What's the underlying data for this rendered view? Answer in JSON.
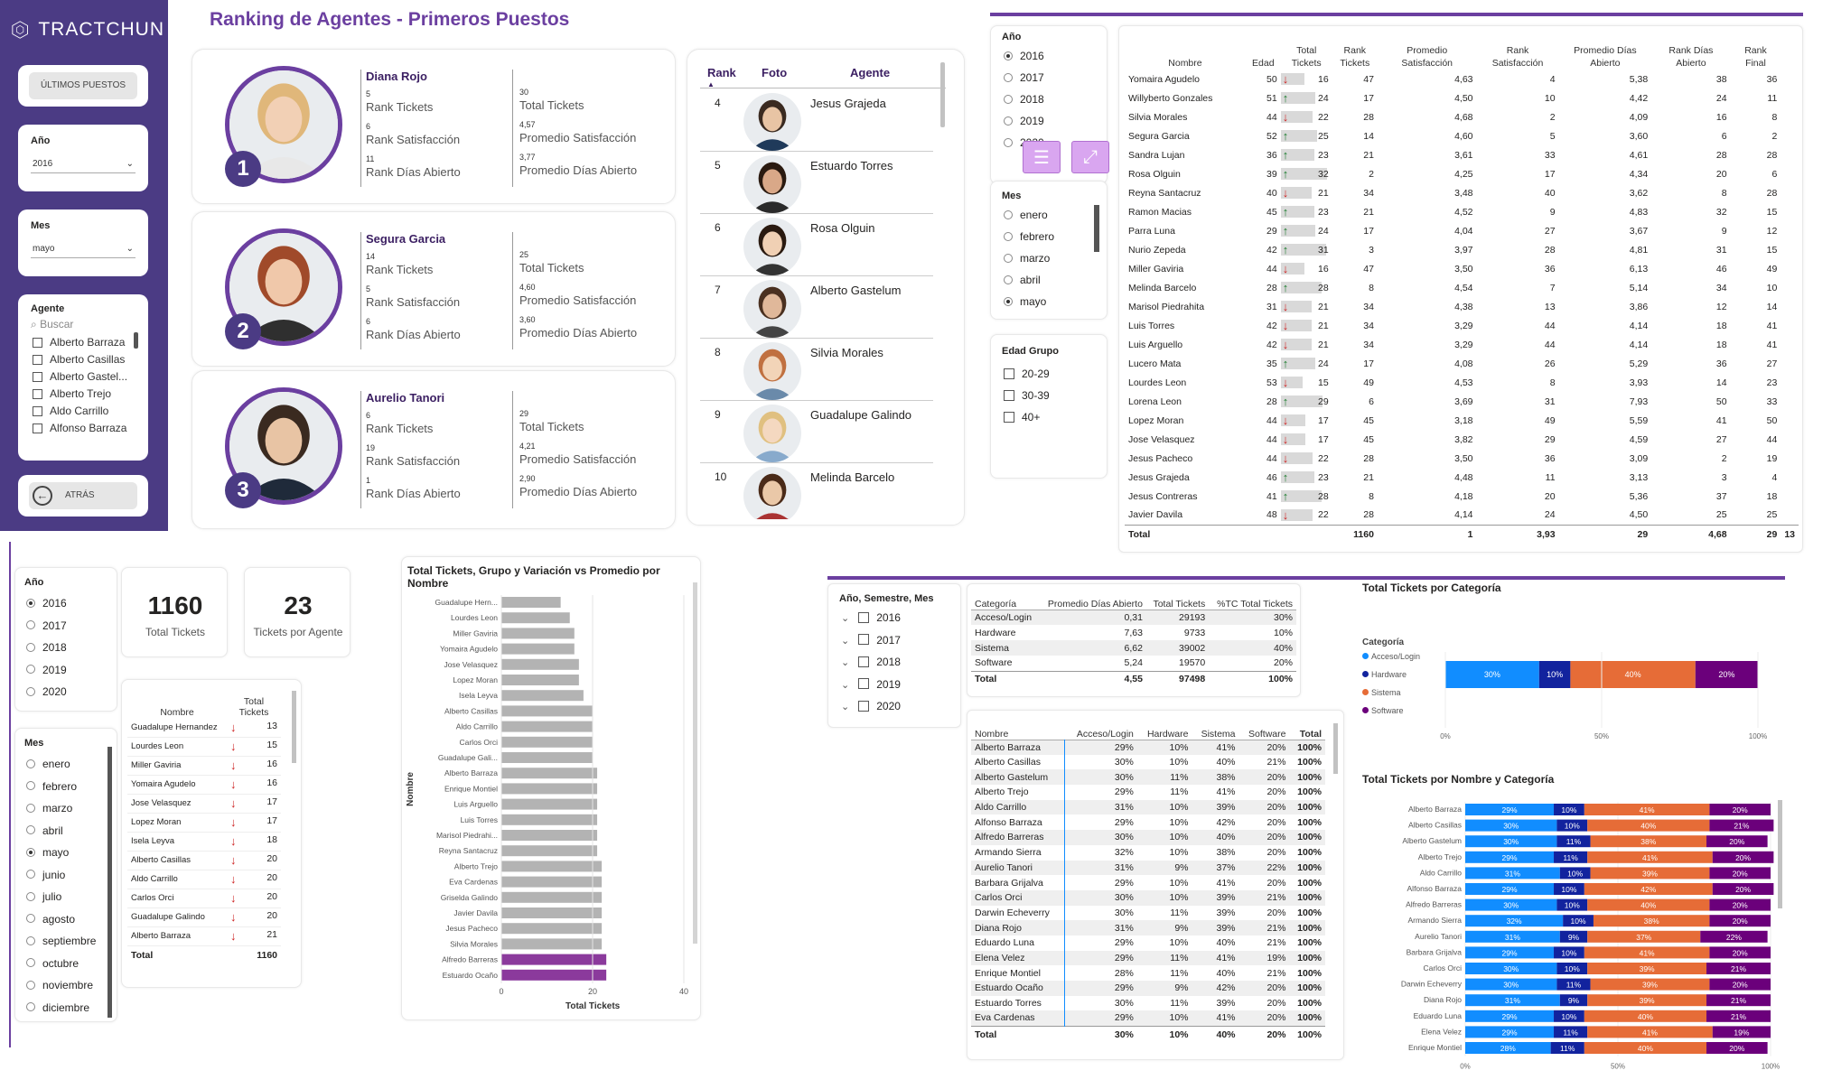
{
  "brand": "TRACTCHUN",
  "sidebar": {
    "ultimos_label": "ÚLTIMOS PUESTOS",
    "year_label": "Año",
    "year_value": "2016",
    "month_label": "Mes",
    "month_value": "mayo",
    "agent_label": "Agente",
    "agent_search_placeholder": "Buscar",
    "agents": [
      "Alberto Barraza",
      "Alberto Casillas",
      "Alberto Gastel...",
      "Alberto Trejo",
      "Aldo Carrillo",
      "Alfonso Barraza"
    ],
    "back_label": "ATRÁS"
  },
  "page_title": "Ranking de Agentes - Primeros Puestos",
  "top3": [
    {
      "rank": "1",
      "name": "Diana Rojo",
      "rank_tickets": "5",
      "rank_tickets_label": "Rank Tickets",
      "rank_sat": "6",
      "rank_sat_label": "Rank Satisfacción",
      "rank_dias": "11",
      "rank_dias_label": "Rank Días Abierto",
      "total_tickets": "30",
      "total_tickets_label": "Total Tickets",
      "prom_sat": "4,57",
      "prom_sat_label": "Promedio Satisfacción",
      "prom_dias": "3,77",
      "prom_dias_label": "Promedio Días Abierto"
    },
    {
      "rank": "2",
      "name": "Segura Garcia",
      "rank_tickets": "14",
      "rank_tickets_label": "Rank Tickets",
      "rank_sat": "5",
      "rank_sat_label": "Rank Satisfacción",
      "rank_dias": "6",
      "rank_dias_label": "Rank Días Abierto",
      "total_tickets": "25",
      "total_tickets_label": "Total Tickets",
      "prom_sat": "4,60",
      "prom_sat_label": "Promedio Satisfacción",
      "prom_dias": "3,60",
      "prom_dias_label": "Promedio Días Abierto"
    },
    {
      "rank": "3",
      "name": "Aurelio Tanori",
      "rank_tickets": "6",
      "rank_tickets_label": "Rank Tickets",
      "rank_sat": "19",
      "rank_sat_label": "Rank Satisfacción",
      "rank_dias": "1",
      "rank_dias_label": "Rank Días Abierto",
      "total_tickets": "29",
      "total_tickets_label": "Total Tickets",
      "prom_sat": "4,21",
      "prom_sat_label": "Promedio Satisfacción",
      "prom_dias": "2,90",
      "prom_dias_label": "Promedio Días Abierto"
    }
  ],
  "rank_list": {
    "headers": [
      "Rank",
      "Foto",
      "Agente"
    ],
    "rows": [
      [
        "4",
        "Jesus Grajeda"
      ],
      [
        "5",
        "Estuardo Torres"
      ],
      [
        "6",
        "Rosa Olguin"
      ],
      [
        "7",
        "Alberto Gastelum"
      ],
      [
        "8",
        "Silvia Morales"
      ],
      [
        "9",
        "Guadalupe Galindo"
      ],
      [
        "10",
        "Melinda Barcelo"
      ]
    ]
  },
  "filters_top": {
    "year_label": "Año",
    "years": [
      "2016",
      "2017",
      "2018",
      "2019",
      "2020"
    ],
    "year_selected": "2016",
    "month_label": "Mes",
    "months": [
      "enero",
      "febrero",
      "marzo",
      "abril",
      "mayo"
    ],
    "month_selected": "mayo",
    "age_label": "Edad Grupo",
    "ages": [
      "20-29",
      "30-39",
      "40+"
    ]
  },
  "big_table": {
    "headers": [
      "Nombre",
      "Edad",
      "Total Tickets",
      "Rank Tickets",
      "Promedio Satisfacción",
      "Rank Satisfacción",
      "Promedio Días Abierto",
      "Rank Días Abierto",
      "Rank Final"
    ],
    "rows": [
      [
        "Yomaira Agudelo",
        "50",
        "dn",
        "16",
        "47",
        "4,63",
        "4",
        "5,38",
        "38",
        "36"
      ],
      [
        "Willyberto Gonzales",
        "51",
        "up",
        "24",
        "17",
        "4,50",
        "10",
        "4,42",
        "24",
        "11"
      ],
      [
        "Silvia Morales",
        "44",
        "dn",
        "22",
        "28",
        "4,68",
        "2",
        "4,09",
        "16",
        "8"
      ],
      [
        "Segura Garcia",
        "52",
        "up",
        "25",
        "14",
        "4,60",
        "5",
        "3,60",
        "6",
        "2"
      ],
      [
        "Sandra Lujan",
        "36",
        "up",
        "23",
        "21",
        "3,61",
        "33",
        "4,61",
        "28",
        "28"
      ],
      [
        "Rosa Olguin",
        "39",
        "up",
        "32",
        "2",
        "4,25",
        "17",
        "4,34",
        "20",
        "6"
      ],
      [
        "Reyna Santacruz",
        "40",
        "dn",
        "21",
        "34",
        "3,48",
        "40",
        "3,62",
        "8",
        "28"
      ],
      [
        "Ramon Macias",
        "45",
        "up",
        "23",
        "21",
        "4,52",
        "9",
        "4,83",
        "32",
        "15"
      ],
      [
        "Parra Luna",
        "29",
        "up",
        "24",
        "17",
        "4,04",
        "27",
        "3,67",
        "9",
        "12"
      ],
      [
        "Nurio Zepeda",
        "42",
        "up",
        "31",
        "3",
        "3,97",
        "28",
        "4,81",
        "31",
        "15"
      ],
      [
        "Miller Gaviria",
        "44",
        "dn",
        "16",
        "47",
        "3,50",
        "36",
        "6,13",
        "46",
        "49"
      ],
      [
        "Melinda Barcelo",
        "28",
        "up",
        "28",
        "8",
        "4,54",
        "7",
        "5,14",
        "34",
        "10"
      ],
      [
        "Marisol Piedrahita",
        "31",
        "dn",
        "21",
        "34",
        "4,38",
        "13",
        "3,86",
        "12",
        "14"
      ],
      [
        "Luis Torres",
        "42",
        "dn",
        "21",
        "34",
        "3,29",
        "44",
        "4,14",
        "18",
        "41"
      ],
      [
        "Luis Arguello",
        "42",
        "dn",
        "21",
        "34",
        "3,29",
        "44",
        "4,14",
        "18",
        "41"
      ],
      [
        "Lucero Mata",
        "35",
        "up",
        "24",
        "17",
        "4,08",
        "26",
        "5,29",
        "36",
        "27"
      ],
      [
        "Lourdes Leon",
        "53",
        "dn",
        "15",
        "49",
        "4,53",
        "8",
        "3,93",
        "14",
        "23"
      ],
      [
        "Lorena Leon",
        "28",
        "up",
        "29",
        "6",
        "3,69",
        "31",
        "7,93",
        "50",
        "33"
      ],
      [
        "Lopez Moran",
        "44",
        "dn",
        "17",
        "45",
        "3,18",
        "49",
        "5,59",
        "41",
        "50"
      ],
      [
        "Jose Velasquez",
        "44",
        "dn",
        "17",
        "45",
        "3,82",
        "29",
        "4,59",
        "27",
        "44"
      ],
      [
        "Jesus Pacheco",
        "44",
        "dn",
        "22",
        "28",
        "3,50",
        "36",
        "3,09",
        "2",
        "19"
      ],
      [
        "Jesus Grajeda",
        "46",
        "up",
        "23",
        "21",
        "4,48",
        "11",
        "3,13",
        "3",
        "4"
      ],
      [
        "Jesus Contreras",
        "41",
        "up",
        "28",
        "8",
        "4,18",
        "20",
        "5,36",
        "37",
        "18"
      ],
      [
        "Javier Davila",
        "48",
        "dn",
        "22",
        "28",
        "4,14",
        "24",
        "4,50",
        "25",
        "25"
      ]
    ],
    "total": [
      "Total",
      "",
      "",
      "1160",
      "1",
      "3,93",
      "29",
      "4,68",
      "29",
      "13"
    ]
  },
  "bl": {
    "year_label": "Año",
    "years": [
      "2016",
      "2017",
      "2018",
      "2019",
      "2020"
    ],
    "year_selected": "2016",
    "month_label": "Mes",
    "months": [
      "enero",
      "febrero",
      "marzo",
      "abril",
      "mayo",
      "junio",
      "julio",
      "agosto",
      "septiembre",
      "octubre",
      "noviembre",
      "diciembre"
    ],
    "month_selected": "mayo",
    "kpi1_value": "1160",
    "kpi1_label": "Total Tickets",
    "kpi2_value": "23",
    "kpi2_label": "Tickets por Agente",
    "small_table": {
      "headers": [
        "Nombre",
        "Total Tickets"
      ],
      "rows": [
        [
          "Guadalupe Hernandez",
          "13"
        ],
        [
          "Lourdes Leon",
          "15"
        ],
        [
          "Miller Gaviria",
          "16"
        ],
        [
          "Yomaira Agudelo",
          "16"
        ],
        [
          "Jose Velasquez",
          "17"
        ],
        [
          "Lopez Moran",
          "17"
        ],
        [
          "Isela Leyva",
          "18"
        ],
        [
          "Alberto Casillas",
          "20"
        ],
        [
          "Aldo Carrillo",
          "20"
        ],
        [
          "Carlos Orci",
          "20"
        ],
        [
          "Guadalupe Galindo",
          "20"
        ],
        [
          "Alberto Barraza",
          "21"
        ]
      ],
      "total": [
        "Total",
        "1160"
      ]
    }
  },
  "bar_chart": {
    "title": "Total Tickets, Grupo y Variación vs Promedio por Nombre"
  },
  "chart_data": [
    {
      "type": "bar",
      "orientation": "horizontal",
      "title": "Total Tickets, Grupo y Variación vs Promedio por Nombre",
      "xlabel": "Total Tickets",
      "ylabel": "Nombre",
      "xlim": [
        0,
        40
      ],
      "xticks": [
        "0",
        "20",
        "40"
      ],
      "categories": [
        "Guadalupe Hern...",
        "Lourdes Leon",
        "Miller Gaviria",
        "Yomaira Agudelo",
        "Jose Velasquez",
        "Lopez Moran",
        "Isela Leyva",
        "Alberto Casillas",
        "Aldo Carrillo",
        "Carlos Orci",
        "Guadalupe Gali...",
        "Alberto Barraza",
        "Enrique Montiel",
        "Luis Arguello",
        "Luis Torres",
        "Marisol Piedrahi...",
        "Reyna Santacruz",
        "Alberto Trejo",
        "Eva Cardenas",
        "Griselda Galindo",
        "Javier Davila",
        "Jesus Pacheco",
        "Silvia Morales",
        "Alfredo Barreras",
        "Estuardo Ocaño"
      ],
      "values": [
        13,
        15,
        16,
        16,
        17,
        17,
        18,
        20,
        20,
        20,
        20,
        21,
        21,
        21,
        21,
        21,
        21,
        22,
        22,
        22,
        22,
        22,
        22,
        23,
        23
      ],
      "highlight": [
        "Alfredo Barreras",
        "Estuardo Ocaño"
      ],
      "bar_color": "#b3b3b3",
      "highlight_color": "#8b3a9c"
    },
    {
      "type": "bar",
      "orientation": "horizontal",
      "stacked_percent": true,
      "title": "Total Tickets por Categoría",
      "legend_title": "Categoría",
      "legend_position": "left",
      "series": [
        {
          "name": "Acceso/Login",
          "values": [
            30
          ]
        },
        {
          "name": "Hardware",
          "values": [
            10
          ]
        },
        {
          "name": "Sistema",
          "values": [
            40
          ]
        },
        {
          "name": "Software",
          "values": [
            20
          ]
        }
      ],
      "xticks": [
        "0%",
        "50%",
        "100%"
      ]
    },
    {
      "type": "bar",
      "orientation": "horizontal",
      "stacked_percent": true,
      "title": "Total Tickets por Nombre y Categoría",
      "xticks": [
        "0%",
        "50%",
        "100%"
      ],
      "categories": [
        "Alberto Barraza",
        "Alberto Casillas",
        "Alberto Gastelum",
        "Alberto Trejo",
        "Aldo Carrillo",
        "Alfonso Barraza",
        "Alfredo Barreras",
        "Armando Sierra",
        "Aurelio Tanori",
        "Barbara Grijalva",
        "Carlos Orci",
        "Darwin Echeverry",
        "Diana Rojo",
        "Eduardo Luna",
        "Elena Velez",
        "Enrique Montiel"
      ],
      "series": [
        {
          "name": "Acceso/Login",
          "values": [
            29,
            30,
            30,
            29,
            31,
            29,
            30,
            32,
            31,
            29,
            30,
            30,
            31,
            29,
            29,
            28
          ]
        },
        {
          "name": "Hardware",
          "values": [
            10,
            10,
            11,
            11,
            10,
            10,
            10,
            10,
            9,
            10,
            10,
            11,
            9,
            10,
            11,
            11
          ]
        },
        {
          "name": "Sistema",
          "values": [
            41,
            40,
            38,
            41,
            39,
            42,
            40,
            38,
            37,
            41,
            39,
            39,
            39,
            40,
            41,
            40
          ]
        },
        {
          "name": "Software",
          "values": [
            20,
            21,
            20,
            20,
            20,
            20,
            20,
            20,
            22,
            20,
            21,
            20,
            21,
            21,
            19,
            20
          ]
        }
      ]
    }
  ],
  "colors": {
    "acceso": "#118dff",
    "hardware": "#12239e",
    "sistema": "#e66c37",
    "software": "#6b007b",
    "purple": "#6b3fa0"
  },
  "br_filters": {
    "title": "Año, Semestre, Mes",
    "years": [
      "2016",
      "2017",
      "2018",
      "2019",
      "2020"
    ]
  },
  "cat_table": {
    "headers": [
      "Categoría",
      "Promedio Días Abierto",
      "Total Tickets",
      "%TC Total Tickets"
    ],
    "rows": [
      [
        "Acceso/Login",
        "0,31",
        "29193",
        "30%"
      ],
      [
        "Hardware",
        "7,63",
        "9733",
        "10%"
      ],
      [
        "Sistema",
        "6,62",
        "39002",
        "40%"
      ],
      [
        "Software",
        "5,24",
        "19570",
        "20%"
      ]
    ],
    "total": [
      "Total",
      "4,55",
      "97498",
      "100%"
    ]
  },
  "matrix": {
    "headers": [
      "Nombre",
      "Acceso/Login",
      "Hardware",
      "Sistema",
      "Software",
      "Total"
    ],
    "rows": [
      [
        "Alberto Barraza",
        "29%",
        "10%",
        "41%",
        "20%",
        "100%"
      ],
      [
        "Alberto Casillas",
        "30%",
        "10%",
        "40%",
        "21%",
        "100%"
      ],
      [
        "Alberto Gastelum",
        "30%",
        "11%",
        "38%",
        "20%",
        "100%"
      ],
      [
        "Alberto Trejo",
        "29%",
        "11%",
        "41%",
        "20%",
        "100%"
      ],
      [
        "Aldo Carrillo",
        "31%",
        "10%",
        "39%",
        "20%",
        "100%"
      ],
      [
        "Alfonso Barraza",
        "29%",
        "10%",
        "42%",
        "20%",
        "100%"
      ],
      [
        "Alfredo Barreras",
        "30%",
        "10%",
        "40%",
        "20%",
        "100%"
      ],
      [
        "Armando Sierra",
        "32%",
        "10%",
        "38%",
        "20%",
        "100%"
      ],
      [
        "Aurelio Tanori",
        "31%",
        "9%",
        "37%",
        "22%",
        "100%"
      ],
      [
        "Barbara Grijalva",
        "29%",
        "10%",
        "41%",
        "20%",
        "100%"
      ],
      [
        "Carlos Orci",
        "30%",
        "10%",
        "39%",
        "21%",
        "100%"
      ],
      [
        "Darwin Echeverry",
        "30%",
        "11%",
        "39%",
        "20%",
        "100%"
      ],
      [
        "Diana Rojo",
        "31%",
        "9%",
        "39%",
        "21%",
        "100%"
      ],
      [
        "Eduardo Luna",
        "29%",
        "10%",
        "40%",
        "21%",
        "100%"
      ],
      [
        "Elena Velez",
        "29%",
        "11%",
        "41%",
        "19%",
        "100%"
      ],
      [
        "Enrique Montiel",
        "28%",
        "11%",
        "40%",
        "21%",
        "100%"
      ],
      [
        "Estuardo Ocaño",
        "29%",
        "9%",
        "42%",
        "20%",
        "100%"
      ],
      [
        "Estuardo Torres",
        "30%",
        "11%",
        "39%",
        "20%",
        "100%"
      ],
      [
        "Eva Cardenas",
        "29%",
        "10%",
        "41%",
        "20%",
        "100%"
      ]
    ],
    "total": [
      "Total",
      "30%",
      "10%",
      "40%",
      "20%",
      "100%"
    ]
  }
}
